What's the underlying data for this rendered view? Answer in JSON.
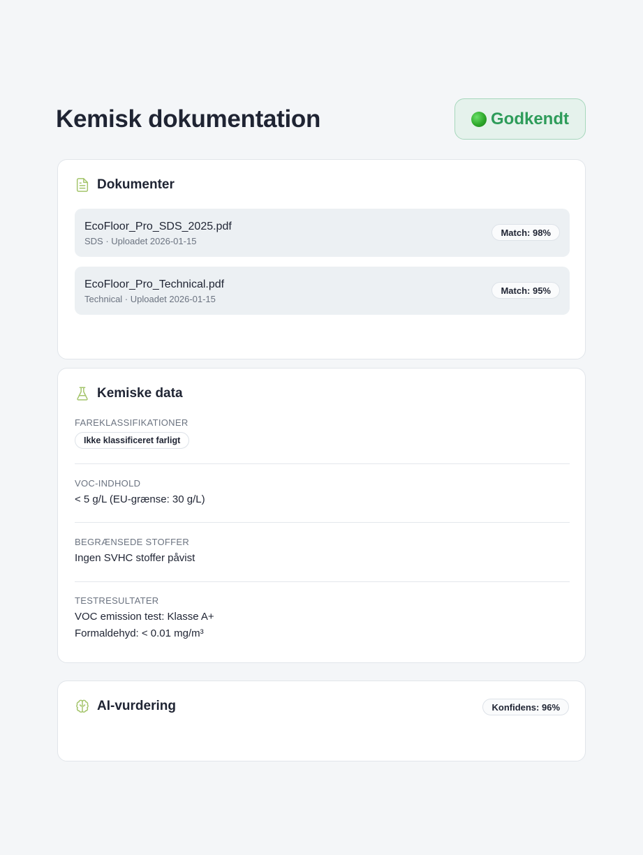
{
  "header": {
    "title": "Kemisk dokumentation",
    "status_label": "Godkendt",
    "status_color": "#2e9c5a"
  },
  "documents": {
    "title": "Dokumenter",
    "icon": "document-icon",
    "items": [
      {
        "name": "EcoFloor_Pro_SDS_2025.pdf",
        "meta": "SDS · Uploadet 2026-01-15",
        "match": "Match: 98%"
      },
      {
        "name": "EcoFloor_Pro_Technical.pdf",
        "meta": "Technical · Uploadet 2026-01-15",
        "match": "Match: 95%"
      }
    ]
  },
  "chemical": {
    "title": "Kemiske data",
    "icon": "flask-icon",
    "hazard": {
      "label": "FAREKLASSIFIKATIONER",
      "tag": "Ikke klassificeret farligt"
    },
    "voc": {
      "label": "VOC-INDHOLD",
      "value": "< 5 g/L (EU-grænse: 30 g/L)"
    },
    "restricted": {
      "label": "BEGRÆNSEDE STOFFER",
      "value": "Ingen SVHC stoffer påvist"
    },
    "tests": {
      "label": "TESTRESULTATER",
      "lines": [
        "VOC emission test: Klasse A+",
        "Formaldehyd: < 0.01 mg/m³"
      ]
    }
  },
  "ai": {
    "title": "AI-vurdering",
    "icon": "brain-icon",
    "confidence": "Konfidens: 96%"
  },
  "colors": {
    "accent_icon": "#a3c46a",
    "badge_bg": "#e5f2ec",
    "badge_border": "#a6d7bc"
  }
}
